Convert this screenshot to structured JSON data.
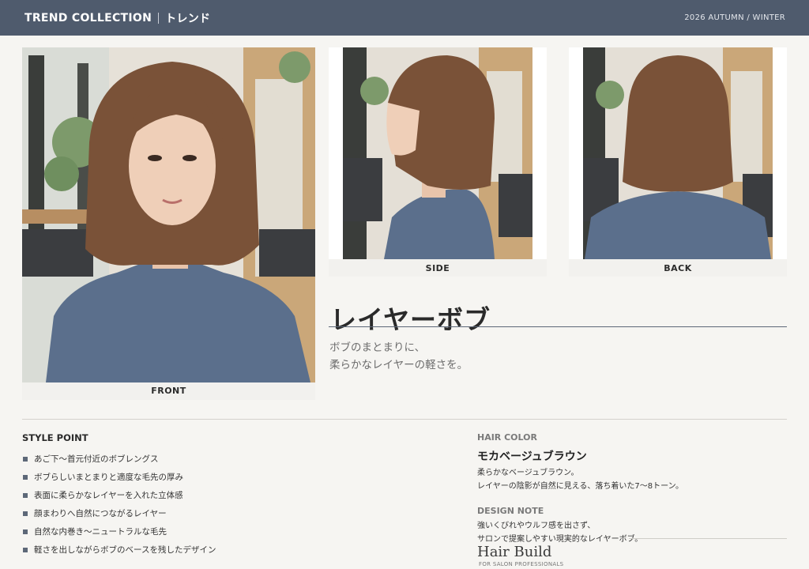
{
  "header": {
    "title_en": "TREND COLLECTION",
    "title_jp": "トレンド",
    "season": "2026 AUTUMN / WINTER"
  },
  "photos": {
    "front_caption": "FRONT",
    "side_caption": "SIDE",
    "back_caption": "BACK"
  },
  "style": {
    "name": "レイヤーボブ",
    "tagline_line1": "ボブのまとまりに、",
    "tagline_line2": "柔らかなレイヤーの軽さを。"
  },
  "style_point": {
    "heading": "STYLE POINT",
    "items": [
      "あご下〜首元付近のボブレングス",
      "ボブらしいまとまりと適度な毛先の厚み",
      "表面に柔らかなレイヤーを入れた立体感",
      "顔まわりへ自然につながるレイヤー",
      "自然な内巻き〜ニュートラルな毛先",
      "軽さを出しながらボブのベースを残したデザイン"
    ]
  },
  "hair_color": {
    "heading": "HAIR COLOR",
    "name": "モカベージュブラウン",
    "desc_line1": "柔らかなベージュブラウン。",
    "desc_line2": "レイヤーの陰影が自然に見える、落ち着いた7〜8トーン。"
  },
  "design_note": {
    "heading": "DESIGN NOTE",
    "line1": "強いくびれやウルフ感を出さず、",
    "line2": "サロンで提案しやすい現実的なレイヤーボブ。"
  },
  "brand": {
    "name": "Hair Build",
    "sub": "FOR SALON PROFESSIONALS"
  },
  "colors": {
    "header_bg": "#4f5b6d",
    "accent": "#5d6878",
    "hair": "#7a5238",
    "blouse": "#5b6f8c"
  }
}
